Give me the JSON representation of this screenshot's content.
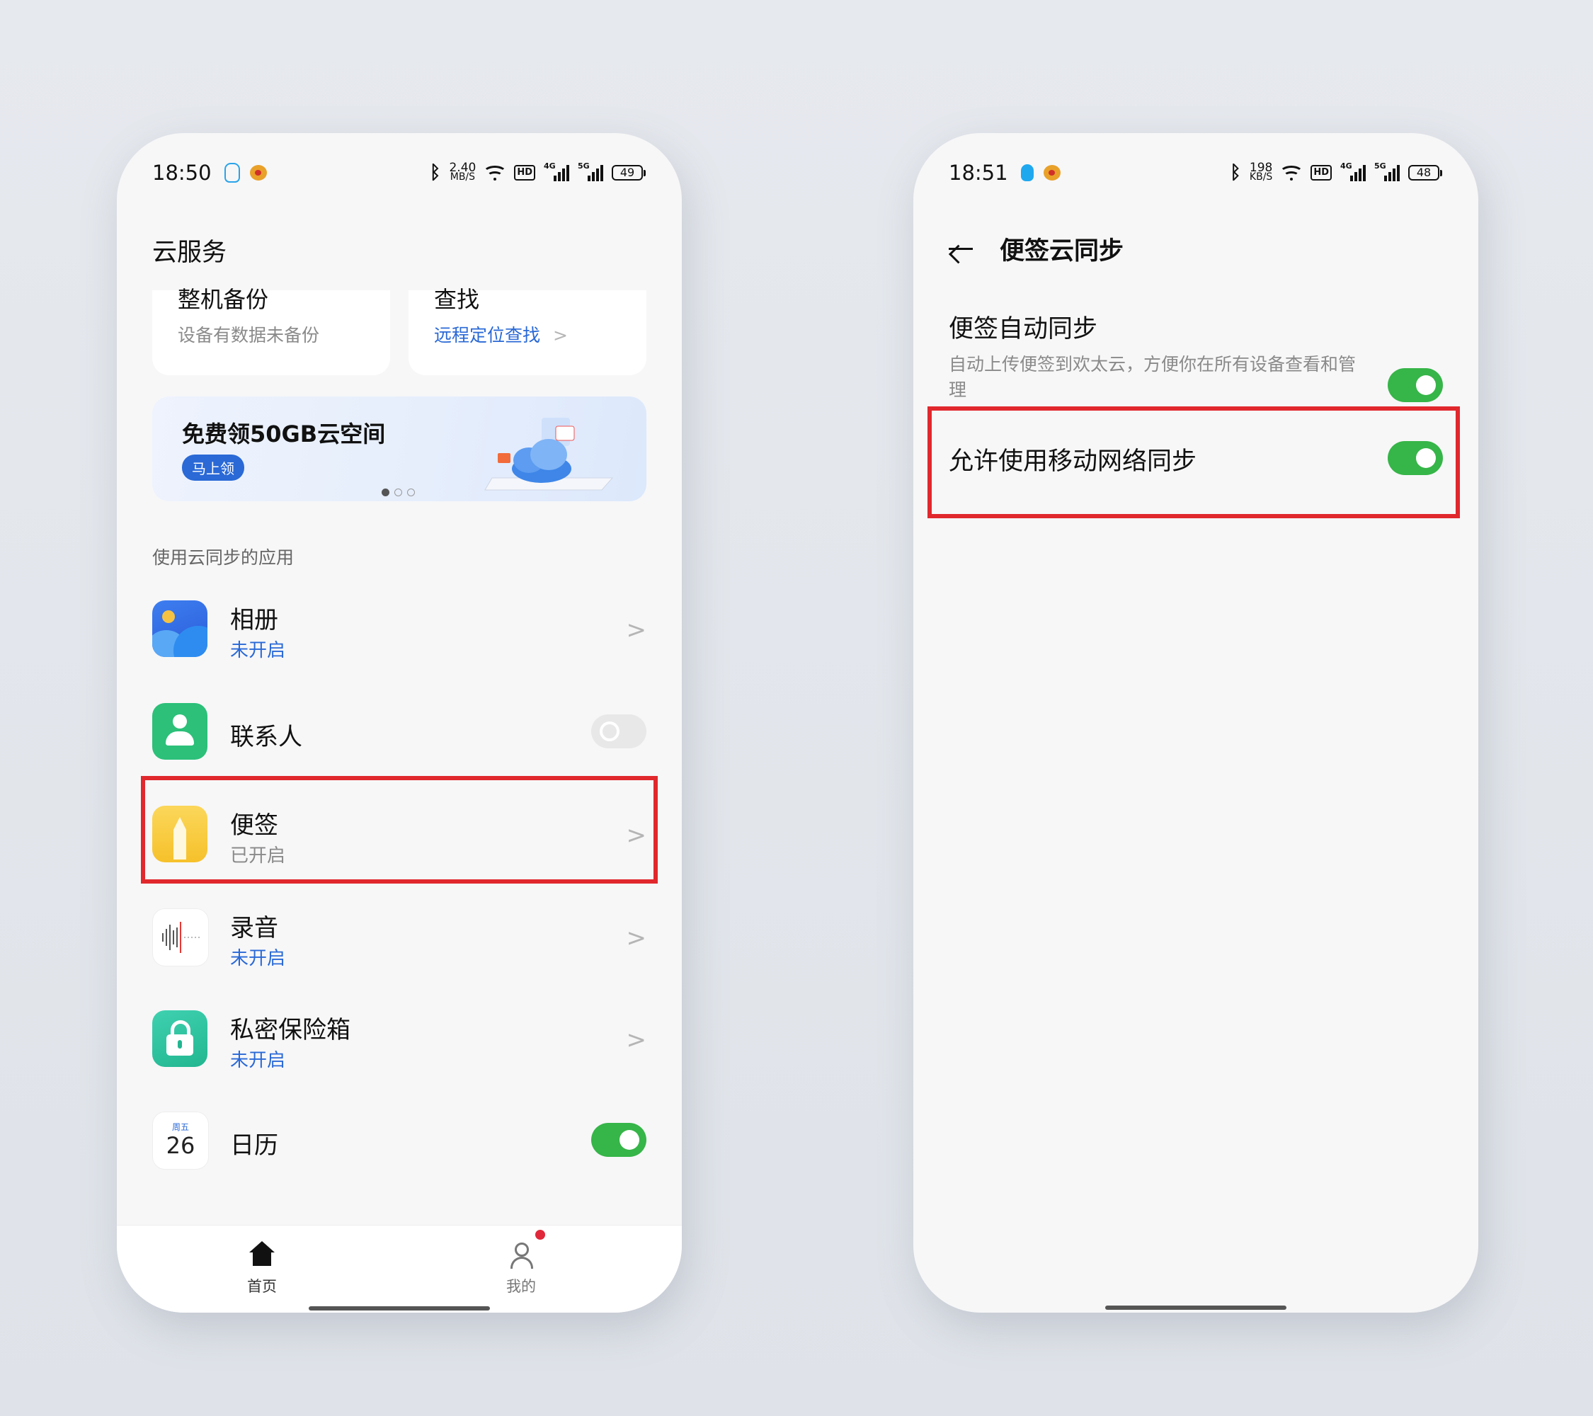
{
  "left": {
    "status": {
      "time": "18:50",
      "speed_value": "2.40",
      "speed_unit": "MB/S",
      "hd": "HD",
      "sig1": "4G",
      "sig2": "5G",
      "battery": "49"
    },
    "title": "云服务",
    "cards": [
      {
        "title": "整机备份",
        "subtitle": "设备有数据未备份"
      },
      {
        "title": "查找",
        "subtitle": "远程定位查找",
        "chevron": ">"
      }
    ],
    "banner": {
      "title": "免费领50GB云空间",
      "button": "马上领"
    },
    "section_label": "使用云同步的应用",
    "apps": [
      {
        "name": "相册",
        "status": "未开启",
        "icon": "gallery-icon"
      },
      {
        "name": "联系人",
        "icon": "contacts-icon",
        "toggle": "off"
      },
      {
        "name": "便签",
        "status": "已开启",
        "icon": "notes-icon"
      },
      {
        "name": "录音",
        "status": "未开启",
        "icon": "recorder-icon"
      },
      {
        "name": "私密保险箱",
        "status": "未开启",
        "icon": "vault-icon"
      },
      {
        "name": "日历",
        "icon": "calendar-icon",
        "toggle": "on",
        "icon_weekday": "周五",
        "icon_day": "26"
      }
    ],
    "chevron": ">",
    "tabs": [
      {
        "label": "首页",
        "icon": "home-icon"
      },
      {
        "label": "我的",
        "icon": "user-icon"
      }
    ]
  },
  "right": {
    "status": {
      "time": "18:51",
      "speed_value": "198",
      "speed_unit": "KB/S",
      "hd": "HD",
      "sig1": "4G",
      "sig2": "5G",
      "battery": "48"
    },
    "title": "便签云同步",
    "settings": [
      {
        "name": "便签自动同步",
        "description": "自动上传便签到欢太云，方便你在所有设备查看和管理",
        "toggle": "on"
      },
      {
        "name": "允许使用移动网络同步",
        "toggle": "on"
      }
    ]
  },
  "colors": {
    "accent_blue": "#2a69d6",
    "toggle_green": "#36b548",
    "highlight_red": "#e0282d"
  }
}
